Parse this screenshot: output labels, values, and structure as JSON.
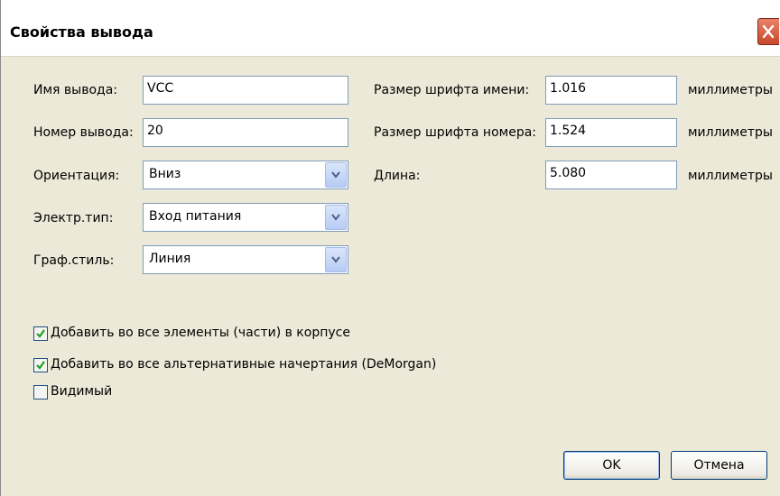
{
  "dialog": {
    "title": "Свойства вывода"
  },
  "left": {
    "pin_name_label": "Имя вывода:",
    "pin_name_value": "VCC",
    "pin_number_label": "Номер вывода:",
    "pin_number_value": "20",
    "orientation_label": "Ориентация:",
    "orientation_value": "Вниз",
    "electrical_type_label": "Электр.тип:",
    "electrical_type_value": "Вход питания",
    "graphic_style_label": "Граф.стиль:",
    "graphic_style_value": "Линия"
  },
  "right": {
    "name_font_size_label": "Размер шрифта имени:",
    "name_font_size_value": "1.016",
    "number_font_size_label": "Размер шрифта номера:",
    "number_font_size_value": "1.524",
    "length_label": "Длина:",
    "length_value": "5.080",
    "unit": "миллиметры"
  },
  "checkboxes": [
    {
      "label": "Добавить во все элементы (части) в корпусе",
      "checked": true
    },
    {
      "label": "Добавить во все альтернативные начертания (DeMorgan)",
      "checked": true
    },
    {
      "label": "Видимый",
      "checked": false
    }
  ],
  "buttons": {
    "ok": "OK",
    "cancel": "Отмена"
  },
  "colors": {
    "dialog_bg": "#ece9d8",
    "field_border": "#7f9db9",
    "check_mark": "#21a121",
    "close_red": "#c8472a"
  },
  "icons": {
    "close": "close-icon",
    "dropdown": "chevron-down-icon",
    "check": "checkmark-icon"
  }
}
